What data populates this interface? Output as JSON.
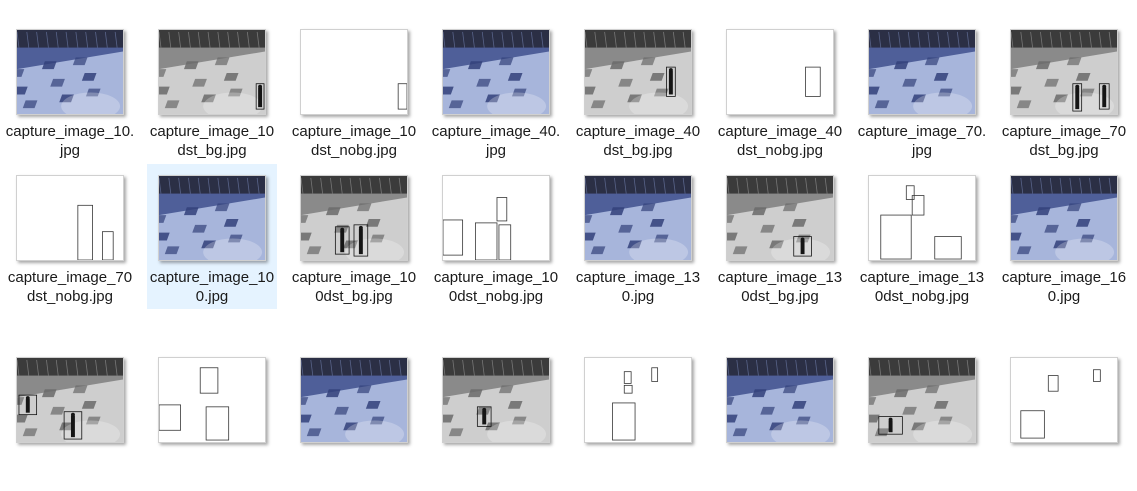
{
  "files": [
    {
      "label": "capture_image_10.jpg",
      "variant": "color"
    },
    {
      "label": "capture_image_10dst_bg.jpg",
      "variant": "gray"
    },
    {
      "label": "capture_image_10dst_nobg.jpg",
      "variant": "white"
    },
    {
      "label": "capture_image_40.jpg",
      "variant": "color"
    },
    {
      "label": "capture_image_40dst_bg.jpg",
      "variant": "gray"
    },
    {
      "label": "capture_image_40dst_nobg.jpg",
      "variant": "white"
    },
    {
      "label": "capture_image_70.jpg",
      "variant": "color"
    },
    {
      "label": "capture_image_70dst_bg.jpg",
      "variant": "gray"
    },
    {
      "label": "capture_image_70dst_nobg.jpg",
      "variant": "white"
    },
    {
      "label": "capture_image_100.jpg",
      "variant": "color",
      "selected": true
    },
    {
      "label": "capture_image_100dst_bg.jpg",
      "variant": "gray"
    },
    {
      "label": "capture_image_100dst_nobg.jpg",
      "variant": "white"
    },
    {
      "label": "capture_image_130.jpg",
      "variant": "color"
    },
    {
      "label": "capture_image_130dst_bg.jpg",
      "variant": "gray"
    },
    {
      "label": "capture_image_130dst_nobg.jpg",
      "variant": "white"
    },
    {
      "label": "capture_image_160.jpg",
      "variant": "color"
    },
    {
      "label": "",
      "variant": "gray"
    },
    {
      "label": "",
      "variant": "white"
    },
    {
      "label": "",
      "variant": "color"
    },
    {
      "label": "",
      "variant": "gray"
    },
    {
      "label": "",
      "variant": "white"
    },
    {
      "label": "",
      "variant": "color"
    },
    {
      "label": "",
      "variant": "gray"
    },
    {
      "label": "",
      "variant": "white"
    }
  ]
}
